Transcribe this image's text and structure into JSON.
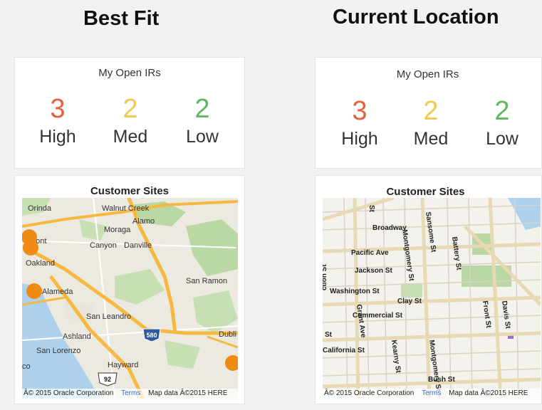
{
  "left": {
    "heading": "Best Fit",
    "ir_card": {
      "title": "My Open IRs",
      "metrics": [
        {
          "value": "3",
          "label": "High",
          "color": "#e4603c"
        },
        {
          "value": "2",
          "label": "Med",
          "color": "#f2c94c"
        },
        {
          "value": "2",
          "label": "Low",
          "color": "#5cb85c"
        }
      ]
    },
    "map_card": {
      "title": "Customer Sites",
      "places": [
        "Orinda",
        "Walnut Creek",
        "Alamo",
        "Moraga",
        "mont",
        "Canyon",
        "Danville",
        "Oakland",
        "San Ramon",
        "Alameda",
        "San Leandro",
        "Dubli",
        "Ashland",
        "San Lorenzo",
        "Hayward",
        "co"
      ],
      "shields": [
        "580",
        "92"
      ],
      "attribution": {
        "copyright": "Â© 2015 Oracle Corporation",
        "terms": "Terms",
        "data": "Map data Â©2015 HERE"
      }
    }
  },
  "right": {
    "heading": "Current Location",
    "ir_card": {
      "title": "My Open IRs",
      "metrics": [
        {
          "value": "3",
          "label": "High",
          "color": "#e4603c"
        },
        {
          "value": "2",
          "label": "Med",
          "color": "#f2c94c"
        },
        {
          "value": "2",
          "label": "Low",
          "color": "#5cb85c"
        }
      ]
    },
    "map_card": {
      "title": "Customer Sites",
      "streets": [
        "Broadway",
        "Pacific Ave",
        "Jackson St",
        "Washington St",
        "Clay St",
        "Commercial St",
        "California St",
        "Bush St",
        "Grant Ave",
        "Kearny St",
        "Montgomery St",
        "Sansome St",
        "Battery St",
        "Front St",
        "Davis St",
        "St",
        "ction St",
        "St"
      ],
      "attribution": {
        "copyright": "Â© 2015 Oracle Corporation",
        "terms": "Terms",
        "data": "Map data Â©2015 HERE"
      }
    }
  }
}
